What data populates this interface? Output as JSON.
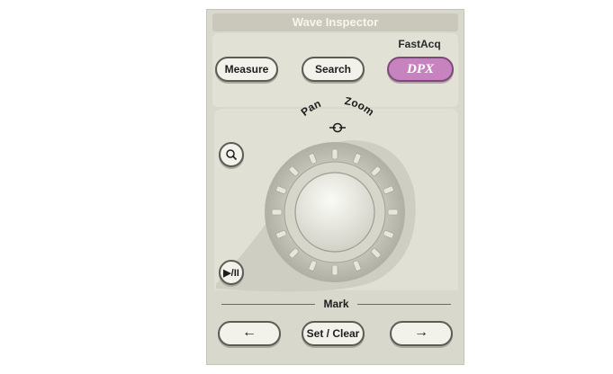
{
  "panel": {
    "title": "Wave Inspector",
    "fastacq_label": "FastAcq",
    "buttons": {
      "measure": "Measure",
      "search": "Search",
      "dpx": "DPX"
    },
    "pan_zoom": {
      "pan_label": "Pan",
      "zoom_label": "Zoom",
      "join_icon": "pan-zoom-join-icon"
    },
    "zoom_button_icon": "magnifier-icon",
    "play_pause": {
      "label": "▶/II",
      "icon": "play-pause-icon"
    },
    "mark": {
      "label": "Mark",
      "prev_arrow": "←",
      "set_clear": "Set / Clear",
      "next_arrow": "→"
    }
  },
  "colors": {
    "panel_bg": "#d9d8cc",
    "dpx_button": "#c783c0",
    "button_face": "#f3f2ea",
    "button_border": "#5c5b55"
  }
}
